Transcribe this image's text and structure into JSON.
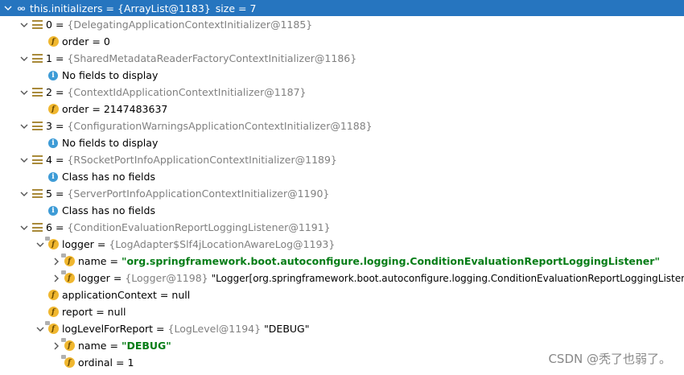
{
  "root": {
    "name": "this.initializers",
    "type": "{ArrayList@1183}",
    "extra": "size = 7",
    "icon": "oo-icon"
  },
  "items": [
    {
      "index": "0",
      "type": "{DelegatingApplicationContextInitializer@1185}",
      "children": [
        {
          "kind": "field",
          "name": "order",
          "value": "0"
        }
      ]
    },
    {
      "index": "1",
      "type": "{SharedMetadataReaderFactoryContextInitializer@1186}",
      "children": [
        {
          "kind": "info",
          "text": "No fields to display"
        }
      ]
    },
    {
      "index": "2",
      "type": "{ContextIdApplicationContextInitializer@1187}",
      "children": [
        {
          "kind": "field",
          "name": "order",
          "value": "2147483637"
        }
      ]
    },
    {
      "index": "3",
      "type": "{ConfigurationWarningsApplicationContextInitializer@1188}",
      "children": [
        {
          "kind": "info",
          "text": "No fields to display"
        }
      ]
    },
    {
      "index": "4",
      "type": "{RSocketPortInfoApplicationContextInitializer@1189}",
      "children": [
        {
          "kind": "info",
          "text": "Class has no fields"
        }
      ]
    },
    {
      "index": "5",
      "type": "{ServerPortInfoApplicationContextInitializer@1190}",
      "children": [
        {
          "kind": "info",
          "text": "Class has no fields"
        }
      ]
    },
    {
      "index": "6",
      "type": "{ConditionEvaluationReportLoggingListener@1191}"
    }
  ],
  "logger": {
    "name": "logger",
    "type": "{LogAdapter$Slf4jLocationAwareLog@1193}"
  },
  "logger_name": {
    "name": "name",
    "value": "\"org.springframework.boot.autoconfigure.logging.ConditionEvaluationReportLoggingListener\""
  },
  "logger_logger": {
    "name": "logger",
    "type": "{Logger@1198}",
    "value": "\"Logger[org.springframework.boot.autoconfigure.logging.ConditionEvaluationReportLoggingListener]\""
  },
  "applicationContext": {
    "name": "applicationContext",
    "value": "null"
  },
  "report": {
    "name": "report",
    "value": "null"
  },
  "logLevelForReport": {
    "name": "logLevelForReport",
    "type": "{LogLevel@1194}",
    "value": "\"DEBUG\""
  },
  "level_name": {
    "name": "name",
    "value": "\"DEBUG\""
  },
  "level_ordinal": {
    "name": "ordinal",
    "value": "1"
  },
  "watermark": "CSDN @秃了也弱了。",
  "colors": {
    "selection": "#2675bf",
    "string": "#067d17",
    "type": "#808080",
    "field_icon": "#f0b72f",
    "info_icon": "#3d9bd6"
  }
}
